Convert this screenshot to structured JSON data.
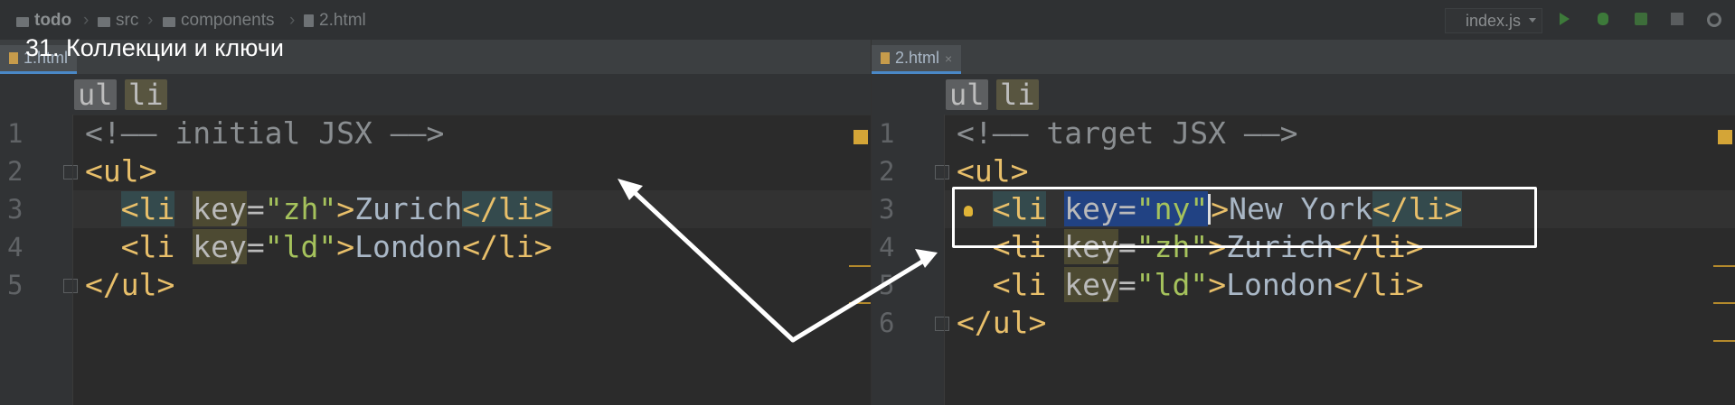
{
  "navbar": {
    "breadcrumbs": [
      "todo",
      "src",
      "components",
      "2.html"
    ],
    "run_config": "index.js"
  },
  "video_title": "31. Коллекции и ключи",
  "left_pane": {
    "tab_label": "1.html",
    "tag_path": [
      "ul",
      "li"
    ],
    "line_numbers": [
      "1",
      "2",
      "3",
      "4",
      "5"
    ],
    "code": {
      "comment": "<!—— initial JSX ——>",
      "ul_open": "<ul>",
      "line3": {
        "open": "<li",
        "attr": "key",
        "eq": "=",
        "val": "\"zh\"",
        "gt": ">",
        "text": "Zurich",
        "close": "</li>"
      },
      "line4": {
        "open": "<li",
        "attr": "key",
        "eq": "=",
        "val": "\"ld\"",
        "gt": ">",
        "text": "London",
        "close": "</li>"
      },
      "ul_close": "</ul>"
    }
  },
  "right_pane": {
    "tab_label": "2.html",
    "tag_path": [
      "ul",
      "li"
    ],
    "line_numbers": [
      "1",
      "2",
      "3",
      "4",
      "5",
      "6"
    ],
    "code": {
      "comment": "<!—— target JSX ——>",
      "ul_open": "<ul>",
      "line3": {
        "open": "<li",
        "attr": "key",
        "eq": "=",
        "val": "\"ny\"",
        "gt": ">",
        "text": "New York",
        "close": "</li>"
      },
      "line4": {
        "open": "<li",
        "attr": "key",
        "eq": "=",
        "val": "\"zh\"",
        "gt": ">",
        "text": "Zurich",
        "close": "</li>"
      },
      "line5": {
        "open": "<li",
        "attr": "key",
        "eq": "=",
        "val": "\"ld\"",
        "gt": ">",
        "text": "London",
        "close": "</li>"
      },
      "ul_close": "</ul>"
    }
  },
  "colors": {
    "background": "#2b2b2b",
    "tag": "#e8bf6a",
    "string": "#a5c25c",
    "selection": "#214283",
    "annotation": "#ffffff"
  },
  "icons": [
    "folder-icon",
    "file-icon",
    "run-icon",
    "debug-icon",
    "coverage-icon",
    "stop-icon",
    "settings-icon",
    "bulb-icon"
  ]
}
